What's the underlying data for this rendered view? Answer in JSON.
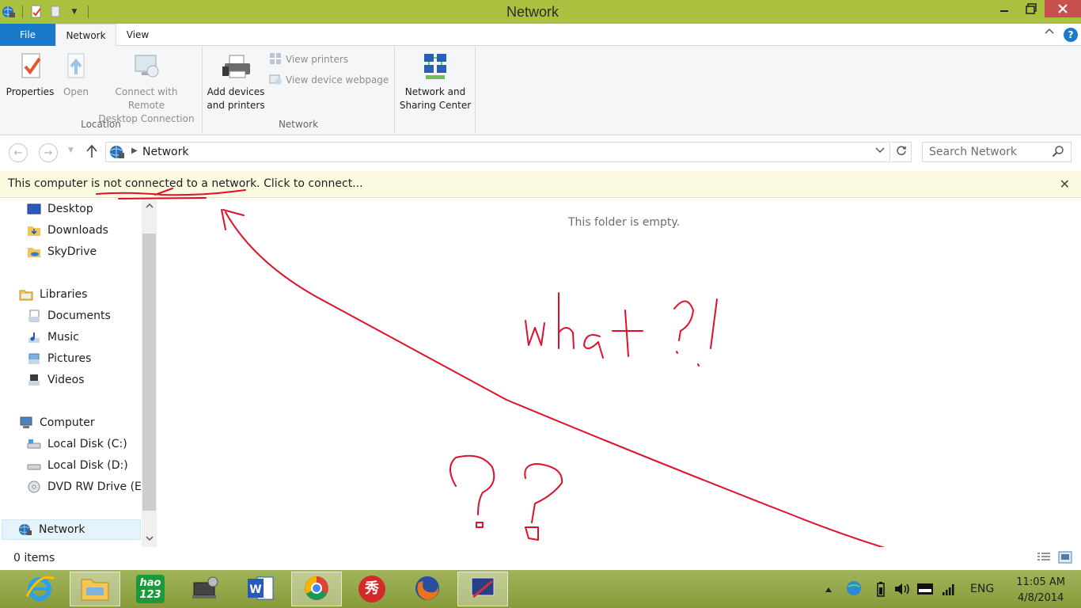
{
  "window": {
    "title": "Network"
  },
  "ribbon_tabs": {
    "file": "File",
    "network": "Network",
    "view": "View"
  },
  "ribbon": {
    "location_group": {
      "label": "Location",
      "properties": "Properties",
      "open": "Open",
      "remote_line1": "Connect with Remote",
      "remote_line2": "Desktop Connection"
    },
    "network_group": {
      "label": "Network",
      "add_line1": "Add devices",
      "add_line2": "and printers",
      "view_printers": "View printers",
      "view_device_webpage": "View device webpage"
    },
    "sharing": {
      "line1": "Network and",
      "line2": "Sharing Center"
    }
  },
  "address": {
    "crumb": "Network",
    "search_placeholder": "Search Network"
  },
  "infobar": {
    "message": "This computer is not connected to a network. Click to connect..."
  },
  "nav": {
    "items": [
      {
        "label": "Desktop",
        "icon": "desktop-icon"
      },
      {
        "label": "Downloads",
        "icon": "downloads-folder-icon"
      },
      {
        "label": "SkyDrive",
        "icon": "skydrive-icon"
      },
      {
        "label": "Libraries",
        "icon": "libraries-icon"
      },
      {
        "label": "Documents",
        "icon": "documents-icon"
      },
      {
        "label": "Music",
        "icon": "music-icon"
      },
      {
        "label": "Pictures",
        "icon": "pictures-icon"
      },
      {
        "label": "Videos",
        "icon": "videos-icon"
      },
      {
        "label": "Computer",
        "icon": "computer-icon"
      },
      {
        "label": "Local Disk (C:)",
        "icon": "local-disk-icon"
      },
      {
        "label": "Local Disk (D:)",
        "icon": "local-disk-icon"
      },
      {
        "label": "DVD RW Drive (E:)",
        "icon": "dvd-drive-icon"
      },
      {
        "label": "Network",
        "icon": "network-icon",
        "selected": true
      }
    ]
  },
  "content": {
    "empty_text": "This folder is empty."
  },
  "status": {
    "items": "0 items"
  },
  "taskbar": {
    "apps": [
      "ie-icon",
      "file-explorer-icon",
      "hao123-icon",
      "settings-app-icon",
      "word-icon",
      "chrome-icon",
      "xiu-app-icon",
      "firefox-icon",
      "paint-app-icon"
    ],
    "hao_label_line1": "hao",
    "hao_label_line2": "123",
    "xiu_label": "秀",
    "language": "ENG",
    "time": "11:05 AM",
    "date": "4/8/2014"
  },
  "colors": {
    "titlebar": "#a9c13e",
    "accent_blue": "#1979ca",
    "close_red": "#c7504c",
    "infobar_bg": "#fcfbe1",
    "annotation_red": "#e0102a"
  }
}
